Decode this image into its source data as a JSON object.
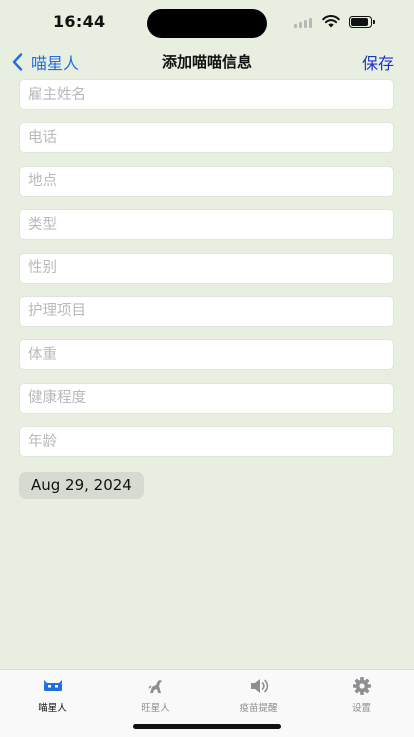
{
  "status_bar": {
    "time": "16:44"
  },
  "nav": {
    "back_label": "喵星人",
    "title": "添加喵喵信息",
    "save_label": "保存"
  },
  "form": {
    "fields": [
      {
        "placeholder": "雇主姓名",
        "value": ""
      },
      {
        "placeholder": "电话",
        "value": ""
      },
      {
        "placeholder": "地点",
        "value": ""
      },
      {
        "placeholder": "类型",
        "value": ""
      },
      {
        "placeholder": "性别",
        "value": ""
      },
      {
        "placeholder": "护理项目",
        "value": ""
      },
      {
        "placeholder": "体重",
        "value": ""
      },
      {
        "placeholder": "健康程度",
        "value": ""
      },
      {
        "placeholder": "年龄",
        "value": ""
      }
    ],
    "date": "Aug 29, 2024"
  },
  "tab_bar": {
    "tabs": [
      {
        "label": "喵星人",
        "icon": "cat-face-icon",
        "active": true
      },
      {
        "label": "旺星人",
        "icon": "dog-icon",
        "active": false
      },
      {
        "label": "疫苗提醒",
        "icon": "speaker-icon",
        "active": false
      },
      {
        "label": "设置",
        "icon": "gear-icon",
        "active": false
      }
    ]
  },
  "colors": {
    "background": "#e8efe1",
    "back_link": "#1f6fe0",
    "save_link": "#1a33c8",
    "tab_inactive": "#8e8e93"
  }
}
